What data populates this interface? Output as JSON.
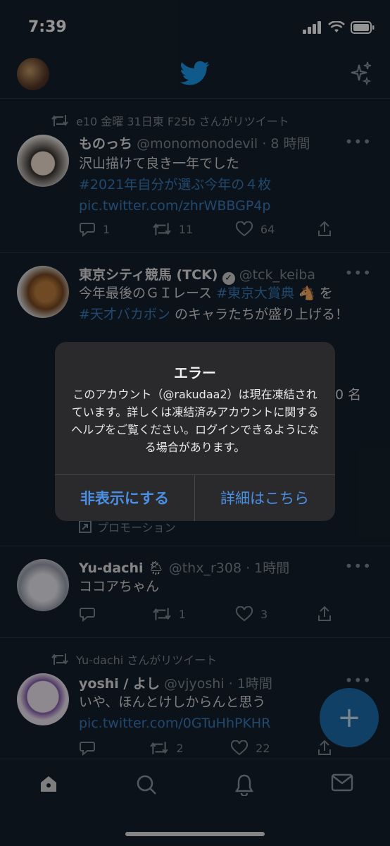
{
  "status": {
    "time": "7:39"
  },
  "tweets": [
    {
      "retweet_line": "e10 金曜 31日東 F25b さんがリツイート",
      "name": "ものっち",
      "handle": "@monomonodevil",
      "time": "· 8 時間",
      "text_line1": "沢山描けて良き一年でした",
      "hashtag": "#2021年自分が選ぶ今年の４枚",
      "link": "pic.twitter.com/zhrWBBGP4p",
      "replies": "1",
      "retweets": "11",
      "likes": "64"
    },
    {
      "name": "東京シティ競馬 (TCK)",
      "handle": "@tck_keiba",
      "text_a": "今年最後のＧＩレース",
      "hashtag_a": "#東京大賞典",
      "text_b": "を",
      "hashtag_b": "#天才バカボン",
      "text_c": "のキャラたちが盛り上げる！",
      "partial_text": "0 名",
      "promotion": "プロモーション"
    },
    {
      "name": "Yu-dachi",
      "handle": "@thx_r308",
      "time": "· 1時間",
      "text": "ココアちゃん",
      "replies": "",
      "retweets": "1",
      "likes": "3"
    },
    {
      "retweet_line": "Yu-dachi さんがリツイート",
      "name": "yoshi / よし",
      "handle": "@vjyoshi",
      "time": "· 1時間",
      "text": "いや、ほんとけしからんと思う",
      "link": "pic.twitter.com/0GTuHhPKHR",
      "replies": "",
      "retweets": "2",
      "likes": "22"
    }
  ],
  "dialog": {
    "title": "エラー",
    "message": "このアカウント（@rakudaa2）は現在凍結されています。詳しくは凍結済みアカウントに関するヘルプをご覧ください。ログインできるようになる場合があります。",
    "hide_label": "非表示にする",
    "details_label": "詳細はこちら"
  },
  "fab": {
    "icon": "+"
  },
  "colors": {
    "background": "#15202b",
    "accent": "#1d9bf0",
    "link": "#3a7fbf",
    "dialog_button": "#4a8fe2"
  },
  "icons": [
    "twitter-bird-icon",
    "sparkle-icon",
    "retweet-icon",
    "reply-icon",
    "like-icon",
    "share-icon",
    "home-icon",
    "search-icon",
    "bell-icon",
    "mail-icon"
  ]
}
